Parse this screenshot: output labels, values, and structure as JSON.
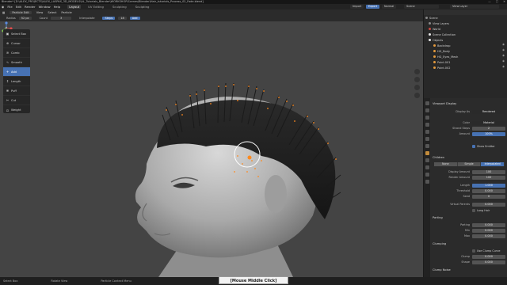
{
  "titlebar": {
    "text": "Blender* [D:\\ALEX_PROJECTS\\ALEX_LASPAS_3D_MODELS\\AL_Tutorials_Blender\\WORKSHOP\\Scenes\\Blender\\Hair_tutorials_Process_02_Fade.blend]",
    "controls": [
      "—",
      "□",
      "✕"
    ]
  },
  "menubar": {
    "items": [
      "File",
      "Edit",
      "Render",
      "Window",
      "Help"
    ],
    "tabs": [
      "Layout",
      "UV Editing",
      "Sculpting",
      "Sculpting"
    ],
    "active_tab": "Layout",
    "right_pills": [
      "Import",
      "Export",
      "Normal"
    ],
    "scene": "Scene",
    "view_layer": "View Layer"
  },
  "viewport_header": {
    "mode": "Particle Edit",
    "items": [
      "View",
      "Select",
      "Particle"
    ]
  },
  "tool_settings": {
    "radius_label": "Radius",
    "radius_value": "52 px",
    "count_label": "Count",
    "count_value": "3",
    "interpolate_label": "Interpolate",
    "steps_label": "Steps",
    "steps_value": "18",
    "add_label": "Add"
  },
  "tools": [
    {
      "label": "Select Box",
      "icon": "select-box-icon",
      "glyph": "▣",
      "active": false
    },
    {
      "label": "Cursor",
      "icon": "cursor-icon",
      "glyph": "⊕",
      "active": false
    },
    {
      "label": "Comb",
      "icon": "comb-icon",
      "glyph": "≋",
      "active": false
    },
    {
      "label": "Smooth",
      "icon": "smooth-icon",
      "glyph": "∿",
      "active": false
    },
    {
      "label": "Add",
      "icon": "add-icon",
      "glyph": "+",
      "active": true
    },
    {
      "label": "Length",
      "icon": "length-icon",
      "glyph": "↕",
      "active": false
    },
    {
      "label": "Puff",
      "icon": "puff-icon",
      "glyph": "❋",
      "active": false
    },
    {
      "label": "Cut",
      "icon": "cut-icon",
      "glyph": "✂",
      "active": false
    },
    {
      "label": "Weight",
      "icon": "weight-icon",
      "glyph": "⚖",
      "active": false
    }
  ],
  "outliner": {
    "rows": [
      {
        "label": "Scene",
        "indent": 1,
        "dot": "#8a8a8a",
        "active": false
      },
      {
        "label": "View Layers",
        "indent": 3,
        "dot": "#8a8a8a",
        "active": false
      },
      {
        "label": "World",
        "indent": 3,
        "dot": "#c8473f",
        "active": false
      },
      {
        "label": "Scene Collection",
        "indent": 3,
        "dot": "#e8e8e8",
        "active": false
      },
      {
        "label": "Objects",
        "indent": 3,
        "dot": "#e8e8e8",
        "active": false
      },
      {
        "label": "Backdrop",
        "indent": 6,
        "dot": "#e39a3d",
        "active": false
      },
      {
        "label": "HG_Body",
        "indent": 6,
        "dot": "#e39a3d",
        "active": false
      },
      {
        "label": "HG_Eyes_Mesh",
        "indent": 6,
        "dot": "#e39a3d",
        "active": false
      },
      {
        "label": "Point.001",
        "indent": 6,
        "dot": "#e39a3d",
        "active": false
      },
      {
        "label": "Point.002",
        "indent": 6,
        "dot": "#e39a3d",
        "active": false
      }
    ]
  },
  "properties": {
    "viewport_display_header": "Viewport Display",
    "display_as_label": "Display As",
    "display_as_value": "Rendered",
    "color_label": "Color",
    "color_value": "Material",
    "strand_steps_label": "Strand Steps",
    "strand_steps_value": "2",
    "amount_label": "Amount",
    "amount_value": "100%",
    "show_emitter": "Show Emitter",
    "children_header": "Children",
    "children_modes": [
      "None",
      "Simple",
      "Interpolated"
    ],
    "children_active": "Interpolated",
    "display_amount_label": "Display Amount",
    "display_amount_value": "100",
    "render_amount_label": "Render Amount",
    "render_amount_value": "100",
    "length_label": "Length",
    "length_value": "1.000",
    "threshold_label": "Threshold",
    "threshold_value": "0.000",
    "seed_label": "Seed",
    "seed_value": "0",
    "virtual_parents_label": "Virtual Parents",
    "virtual_parents_value": "0.000",
    "long_hair": "Long Hair",
    "parting_header": "Parting",
    "parting_label": "Parting",
    "parting_value": "0.000",
    "min_label": "Min",
    "min_value": "0.000",
    "max_label": "Max",
    "max_value": "0.000",
    "clumping_header": "Clumping",
    "use_clump_curve": "Use Clump Curve",
    "clump_label": "Clump",
    "clump_value": "0.000",
    "shape_label": "Shape",
    "shape_value": "0.000",
    "clump_noise_header": "Clump Noise"
  },
  "statusbar": {
    "items": [
      "Select Box",
      "Rotate View",
      "Particle Context Menu"
    ]
  },
  "caption": "[Mouse Middle Click]",
  "colors": {
    "accent_blue": "#4772b3",
    "particle_orange": "#ff8a1e",
    "viewport_bg": "#444444"
  }
}
